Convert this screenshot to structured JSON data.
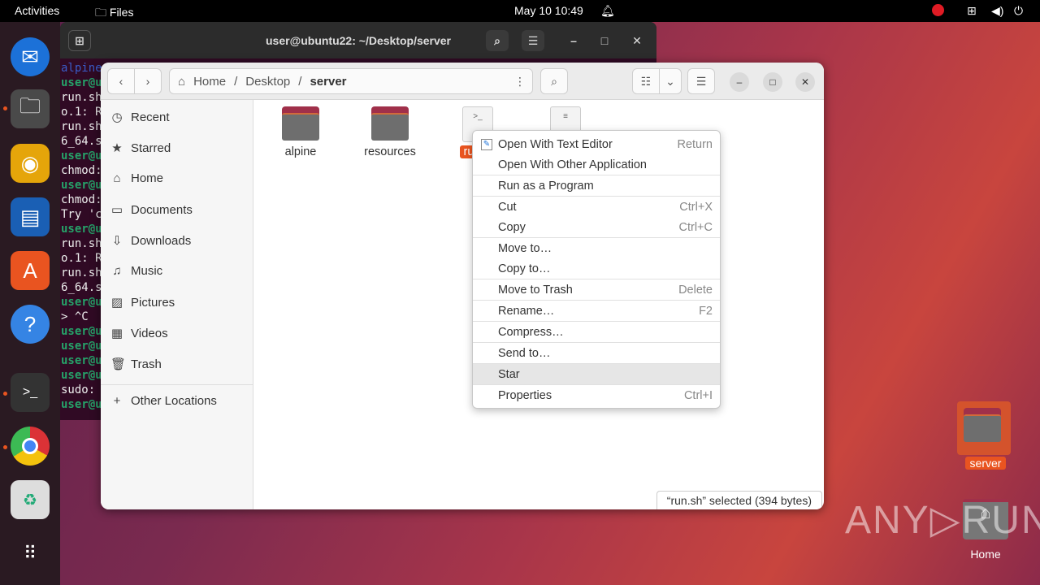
{
  "topbar": {
    "activities": "Activities",
    "app": "Files",
    "clock": "May 10  10:49"
  },
  "dock": [
    "Thunderbird",
    "Files",
    "Rhythmbox",
    "LibreOffice Writer",
    "Ubuntu Software",
    "Help",
    "Terminal",
    "Google Chrome",
    "Trash",
    "Show Applications"
  ],
  "terminal": {
    "title": "user@ubuntu22: ~/Desktop/server",
    "lines": [
      {
        "t": "alpine",
        "c": "b"
      },
      {
        "t": "user@u",
        "c": "g"
      },
      {
        "t": "run.sh",
        "c": ""
      },
      {
        "t": "o.1: R",
        "c": ""
      },
      {
        "t": "run.sh",
        "c": ""
      },
      {
        "t": "6_64.s",
        "c": ""
      },
      {
        "t": "user@u",
        "c": "g"
      },
      {
        "t": "chmod:",
        "c": ""
      },
      {
        "t": "user@u",
        "c": "g"
      },
      {
        "t": "chmod:",
        "c": ""
      },
      {
        "t": "Try 'c",
        "c": ""
      },
      {
        "t": "user@u",
        "c": "g"
      },
      {
        "t": "run.sh",
        "c": ""
      },
      {
        "t": "o.1: R",
        "c": ""
      },
      {
        "t": "run.sh",
        "c": ""
      },
      {
        "t": "6_64.s",
        "c": ""
      },
      {
        "t": "user@u",
        "c": "g"
      },
      {
        "t": "> ^C",
        "c": ""
      },
      {
        "t": "user@u",
        "c": "g"
      },
      {
        "t": "user@u",
        "c": "g"
      },
      {
        "t": "user@u",
        "c": "g"
      },
      {
        "t": "user@u",
        "c": "g"
      },
      {
        "t": "sudo:",
        "c": ""
      },
      {
        "t": "user@u",
        "c": "g"
      }
    ]
  },
  "files": {
    "breadcrumb": [
      "Home",
      "Desktop",
      "server"
    ],
    "sidebar": [
      {
        "label": "Recent",
        "icon": "clock-icon"
      },
      {
        "label": "Starred",
        "icon": "star-icon"
      },
      {
        "label": "Home",
        "icon": "home-icon"
      },
      {
        "label": "Documents",
        "icon": "document-icon"
      },
      {
        "label": "Downloads",
        "icon": "download-icon"
      },
      {
        "label": "Music",
        "icon": "music-icon"
      },
      {
        "label": "Pictures",
        "icon": "picture-icon"
      },
      {
        "label": "Videos",
        "icon": "video-icon"
      },
      {
        "label": "Trash",
        "icon": "trash-icon"
      },
      {
        "label": "Other Locations",
        "icon": "plus-icon"
      }
    ],
    "items": [
      {
        "name": "alpine",
        "type": "folder"
      },
      {
        "name": "resources",
        "type": "folder"
      },
      {
        "name": "ru",
        "type": "script"
      },
      {
        "name": "",
        "type": "text"
      }
    ],
    "status": "“run.sh” selected  (394 bytes)"
  },
  "context_menu": [
    {
      "label": "Open With Text Editor",
      "accel": "Return"
    },
    {
      "label": "Open With Other Application",
      "accel": ""
    },
    {
      "label": "Run as a Program",
      "accel": ""
    },
    {
      "label": "Cut",
      "accel": "Ctrl+X"
    },
    {
      "label": "Copy",
      "accel": "Ctrl+C"
    },
    {
      "label": "Move to…",
      "accel": ""
    },
    {
      "label": "Copy to…",
      "accel": ""
    },
    {
      "label": "Move to Trash",
      "accel": "Delete"
    },
    {
      "label": "Rename…",
      "accel": "F2"
    },
    {
      "label": "Compress…",
      "accel": ""
    },
    {
      "label": "Send to…",
      "accel": ""
    },
    {
      "label": "Star",
      "accel": ""
    },
    {
      "label": "Properties",
      "accel": "Ctrl+I"
    }
  ],
  "desktop": {
    "server": "server",
    "home": "Home",
    "watermark": "ANY RUN"
  }
}
